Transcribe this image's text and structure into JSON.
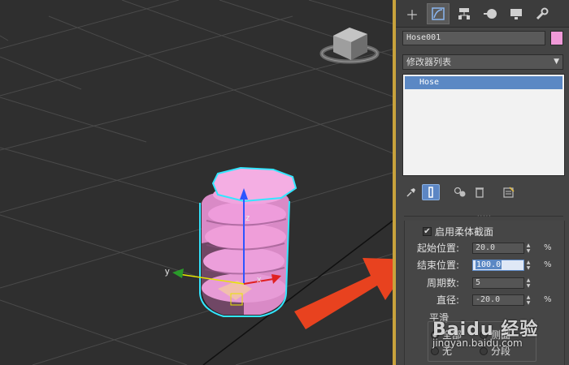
{
  "command_panel": {
    "tabs": [
      {
        "name": "create",
        "icon": "plus-icon"
      },
      {
        "name": "modify",
        "icon": "modify-curve-icon"
      },
      {
        "name": "hierarchy",
        "icon": "hierarchy-icon"
      },
      {
        "name": "motion",
        "icon": "motion-icon"
      },
      {
        "name": "display",
        "icon": "monitor-icon"
      },
      {
        "name": "utilities",
        "icon": "wrench-icon"
      }
    ],
    "object_name": "Hose001",
    "object_color": "#f09ad8",
    "modifier_list_label": "修改器列表",
    "stack_items": [
      "Hose"
    ],
    "stack_tools": [
      "pin-stack-icon",
      "show-end-result-icon",
      "make-unique-icon",
      "remove-modifier-icon",
      "configure-sets-icon"
    ]
  },
  "rollout": {
    "enable_flex": {
      "label": "启用柔体截面",
      "checked": true
    },
    "params": [
      {
        "label": "起始位置:",
        "value": "20.0",
        "unit": "%"
      },
      {
        "label": "结束位置:",
        "value": "100.0",
        "unit": "%",
        "focused": true
      },
      {
        "label": "周期数:",
        "value": "5",
        "unit": ""
      },
      {
        "label": "直径:",
        "value": "-20.0",
        "unit": "%"
      }
    ],
    "smooth_group": {
      "title": "平滑",
      "options": [
        "全部",
        "侧面",
        "无",
        "分段"
      ]
    }
  },
  "viewport": {
    "axis_labels": {
      "x": "x",
      "y": "y"
    },
    "accent_color": "#f09ad8",
    "selection_color": "#33e6ff"
  },
  "watermark": {
    "text": "Baidu 经验",
    "sub": "jingyan.baidu.com"
  }
}
